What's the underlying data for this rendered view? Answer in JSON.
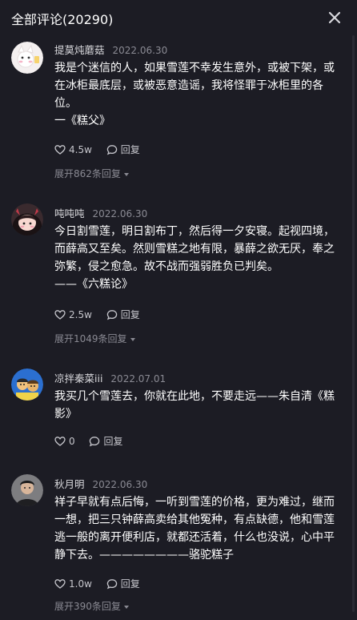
{
  "header": {
    "title": "全部评论(20290)"
  },
  "comments": [
    {
      "username": "提莫炖蘑菇",
      "date": "2022.06.30",
      "content": "我是个迷信的人，如果雪莲不幸发生意外，或被下架，或在冰柜最底层，或被恶意造谣，我将怪罪于冰柜里的各位。\n一《糕父》",
      "likes": "4.5w",
      "reply_label": "回复",
      "expand_label": "展开862条回复"
    },
    {
      "username": "吨吨吨",
      "date": "2022.06.30",
      "content": "今日割雪莲，明日割布丁，然后得一夕安寝。起视四境，而薛高又至矣。然则雪糕之地有限，暴薛之欲无厌，奉之弥繁，侵之愈急。故不战而强弱胜负已判矣。\n——《六糕论》",
      "likes": "2.5w",
      "reply_label": "回复",
      "expand_label": "展开1049条回复"
    },
    {
      "username": "凉拌秦菜iii",
      "date": "2022.07.01",
      "content": "我买几个雪莲去，你就在此地，不要走远——朱自清《糕影》",
      "likes": "0",
      "reply_label": "回复",
      "expand_label": ""
    },
    {
      "username": "秋月明",
      "date": "2022.06.30",
      "content": "祥子早就有点后悔，一听到雪莲的价格，更为难过，继而一想，把三只钟薛高卖给其他冤种，有点缺德，他和雪莲逃一般的离开便利店，就都还活着，什么也没说，心中平静下去。————————骆驼糕子",
      "likes": "1.0w",
      "reply_label": "回复",
      "expand_label": "展开390条回复"
    }
  ],
  "colors": {
    "background": "#1c1c24",
    "text": "#ffffff",
    "muted": "#8a8a93",
    "username": "#d7d7db"
  },
  "icons": {
    "close": "close-icon",
    "like": "heart-outline-icon",
    "reply": "comment-bubble-icon",
    "expand": "caret-down-icon"
  }
}
